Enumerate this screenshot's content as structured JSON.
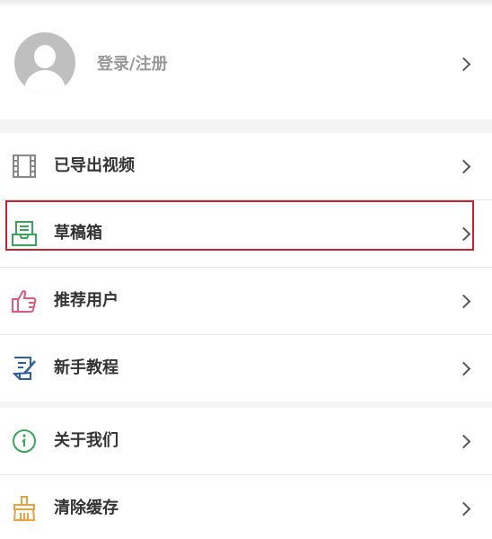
{
  "profile": {
    "login_label": "登录/注册"
  },
  "menu_group_1": [
    {
      "label": "已导出视频",
      "icon": "film-icon",
      "color": "#888888"
    },
    {
      "label": "草稿箱",
      "icon": "draft-box-icon",
      "color": "#3aa55a"
    },
    {
      "label": "推荐用户",
      "icon": "thumbs-up-icon",
      "color": "#e0587a"
    },
    {
      "label": "新手教程",
      "icon": "edit-document-icon",
      "color": "#2b5fa8"
    }
  ],
  "menu_group_2": [
    {
      "label": "关于我们",
      "icon": "info-icon",
      "color": "#3aa55a"
    },
    {
      "label": "清除缓存",
      "icon": "broom-icon",
      "color": "#e8a040"
    }
  ]
}
